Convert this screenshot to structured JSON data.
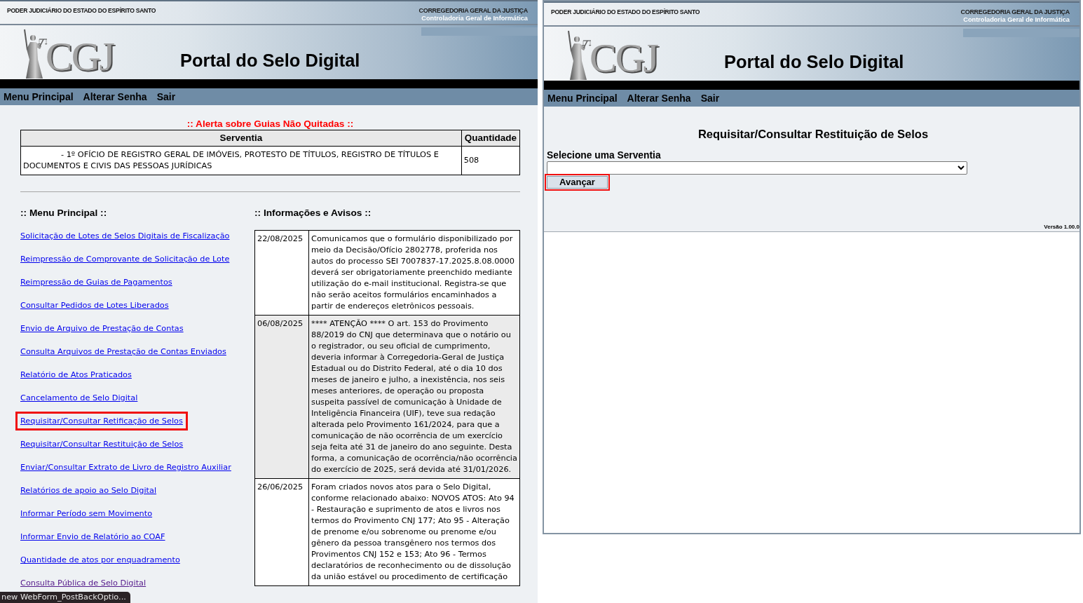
{
  "left_window": {
    "header": {
      "org": "PODER JUDICIÁRIO DO ESTADO DO ESPÍRITO SANTO",
      "dept": "CORREGEDORIA GERAL DA JUSTIÇA",
      "subdept": "Controladoria Geral de Informática",
      "logo_text": "CGJ",
      "title": "Portal do Selo Digital"
    },
    "nav": [
      {
        "label": "Menu Principal"
      },
      {
        "label": "Alterar Senha"
      },
      {
        "label": "Sair"
      }
    ],
    "alert": {
      "title": ":: Alerta sobre Guias Não Quitadas ::",
      "columns": [
        "Serventia",
        "Quantidade"
      ],
      "rows": [
        [
          "- 1º OFÍCIO DE REGISTRO GERAL DE IMÓVEIS, PROTESTO DE TÍTULOS, REGISTRO DE TÍTULOS E DOCUMENTOS E CIVIS DAS PESSOAS JURÍDICAS",
          "508"
        ]
      ]
    },
    "menu": {
      "heading": ":: Menu Principal ::",
      "items": [
        {
          "label": "Solicitação de Lotes de Selos Digitais de Fiscalização",
          "visited": false,
          "highlighted": false
        },
        {
          "label": "Reimpressão de Comprovante de Solicitação de Lote",
          "visited": false,
          "highlighted": false
        },
        {
          "label": "Reimpressão de Guias de Pagamentos",
          "visited": false,
          "highlighted": false
        },
        {
          "label": "Consultar Pedidos de Lotes Liberados",
          "visited": false,
          "highlighted": false
        },
        {
          "label": "Envio de Arquivo de Prestação de Contas",
          "visited": false,
          "highlighted": false
        },
        {
          "label": "Consulta Arquivos de Prestação de Contas Enviados",
          "visited": false,
          "highlighted": false
        },
        {
          "label": "Relatório de Atos Praticados",
          "visited": false,
          "highlighted": false
        },
        {
          "label": "Cancelamento de Selo Digital",
          "visited": false,
          "highlighted": false
        },
        {
          "label": "Requisitar/Consultar Retificação de Selos",
          "visited": false,
          "highlighted": true
        },
        {
          "label": "Requisitar/Consultar Restituição de Selos",
          "visited": false,
          "highlighted": false
        },
        {
          "label": "Enviar/Consultar Extrato de Livro de Registro Auxiliar",
          "visited": false,
          "highlighted": false
        },
        {
          "label": "Relatórios de apoio ao Selo Digital",
          "visited": false,
          "highlighted": false
        },
        {
          "label": "Informar Período sem Movimento",
          "visited": false,
          "highlighted": false
        },
        {
          "label": "Informar Envio de Relatório ao COAF",
          "visited": false,
          "highlighted": false
        },
        {
          "label": "Quantidade de atos por enquadramento",
          "visited": false,
          "highlighted": false
        },
        {
          "label": "Consulta Pública de Selo Digital",
          "visited": true,
          "highlighted": false
        }
      ]
    },
    "notices": {
      "heading": ":: Informações e Avisos ::",
      "rows": [
        {
          "date": "22/08/2025",
          "text": "Comunicamos que o formulário disponibilizado por meio da Decisão/Ofício 2802778, proferida nos autos do processo SEI 7007837-17.2025.8.08.0000 deverá ser obrigatoriamente preenchido mediante utilização do e-mail institucional. Registra-se que não serão aceitos formulários encaminhados a partir de endereços eletrônicos pessoais."
        },
        {
          "date": "06/08/2025",
          "text": "**** ATENÇÃO **** O art. 153 do Provimento 88/2019 do CNJ que determinava que o notário ou o registrador, ou seu oficial de cumprimento, deveria informar à Corregedoria-Geral de Justiça Estadual ou do Distrito Federal, até o dia 10 dos meses de janeiro e julho, a inexistência, nos seis meses anteriores, de operação ou proposta suspeita passível de comunicação à Unidade de Inteligência Financeira (UIF), teve sua redação alterada pelo Provimento 161/2024, para que a comunicação de não ocorrência de um exercício seja feita até 31 de janeiro do ano seguinte. Desta forma, a comunicação de ocorrência/não ocorrência do exercício de 2025, será devida até 31/01/2026."
        },
        {
          "date": "26/06/2025",
          "text": "Foram criados novos atos para o Selo Digital, conforme relacionado abaixo: NOVOS ATOS: Ato 94 - Restauração e suprimento de atos e livros nos termos do Provimento CNJ 177; Ato 95 - Alteração de prenome e/ou sobrenome ou prenome e/ou gênero da pessoa transgênero nos termos dos Provimentos CNJ 152 e 153; Ato 96 - Termos declaratórios de reconhecimento ou de dissolução da união estável ou procedimento de certificação"
        }
      ]
    },
    "status_text": "new WebForm_PostBackOptio..."
  },
  "right_window": {
    "header": {
      "org": "PODER JUDICIÁRIO DO ESTADO DO ESPÍRITO SANTO",
      "dept": "CORREGEDORIA GERAL DA JUSTIÇA",
      "subdept": "Controladoria Geral de Informática",
      "logo_text": "CGJ",
      "title": "Portal do Selo Digital"
    },
    "nav": [
      {
        "label": "Menu Principal"
      },
      {
        "label": "Alterar Senha"
      },
      {
        "label": "Sair"
      }
    ],
    "form": {
      "title": "Requisitar/Consultar Restituição de Selos",
      "label": "Selecione uma Serventia",
      "button": {
        "label": "Avançar",
        "highlighted": true
      }
    },
    "version": "Versão 1.00.0"
  }
}
